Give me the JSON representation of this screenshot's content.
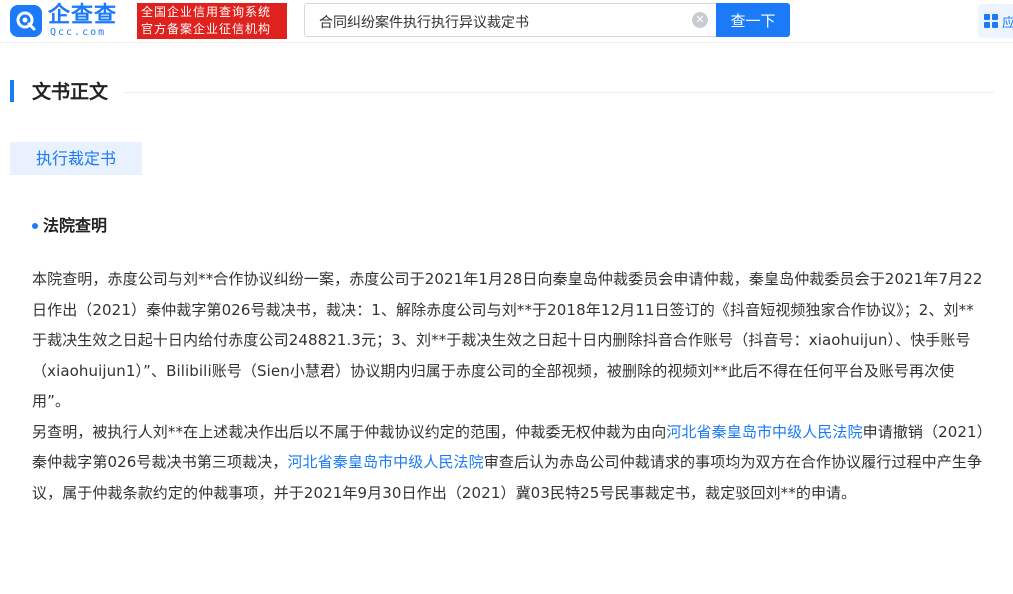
{
  "header": {
    "logo_text": "企查查",
    "logo_sub": "Qcc.com",
    "badge_line1": "全国企业信用查询系统",
    "badge_line2": "官方备案企业征信机构",
    "search_value": "合同纠纷案件执行执行异议裁定书",
    "search_button": "查一下",
    "app_label": "应"
  },
  "section": {
    "title": "文书正文",
    "doc_tag": "执行裁定书",
    "sub_title": "法院查明"
  },
  "content": {
    "p1": "本院查明，赤度公司与刘**合作协议纠纷一案，赤度公司于2021年1月28日向秦皇岛仲裁委员会申请仲裁，秦皇岛仲裁委员会于2021年7月22日作出（2021）秦仲裁字第026号裁决书，裁决：1、解除赤度公司与刘**于2018年12月11日签订的《抖音短视频独家合作协议》；2、刘**于裁决生效之日起十日内给付赤度公司248821.3元；3、刘**于裁决生效之日起十日内删除抖音合作账号（抖音号：xiaohuijun）、快手账号（xiaohuijun1）”、Bilibili账号（Sien小慧君）协议期内归属于赤度公司的全部视频，被删除的视频刘**此后不得在任何平台及账号再次使用”。",
    "p2_a": "另查明，被执行人刘**在上述裁决作出后以不属于仲裁协议约定的范围，仲裁委无权仲裁为由向",
    "p2_link1": "河北省秦皇岛市中级人民法院",
    "p2_b": "申请撤销（2021）秦仲裁字第026号裁决书第三项裁决，",
    "p2_link2": "河北省秦皇岛市中级人民法院",
    "p2_c": "审查后认为赤岛公司仲裁请求的事项均为双方在合作协议履行过程中产生争议，属于仲裁条款约定的仲裁事项，并于2021年9月30日作出（2021）冀03民特25号民事裁定书，裁定驳回刘**的申请。"
  },
  "colors": {
    "brand": "#1a7af8",
    "badge": "#e0221e"
  },
  "icons": [
    "qcc-logo-icon",
    "clear-icon",
    "app-grid-icon"
  ]
}
